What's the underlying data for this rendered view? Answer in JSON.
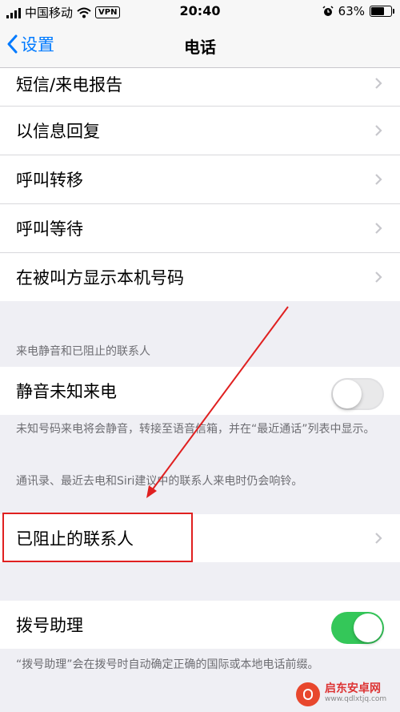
{
  "status_bar": {
    "carrier": "中国移动",
    "vpn": "VPN",
    "time": "20:40",
    "battery": "63%",
    "battery_level": 0.63,
    "icons": [
      "signal-icon",
      "wifi-icon",
      "alarm-icon",
      "battery-icon"
    ]
  },
  "nav": {
    "back_label": "设置",
    "title": "电话"
  },
  "group1": {
    "items": [
      {
        "label": "短信/来电报告"
      },
      {
        "label": "以信息回复"
      },
      {
        "label": "呼叫转移"
      },
      {
        "label": "呼叫等待"
      },
      {
        "label": "在被叫方显示本机号码"
      }
    ]
  },
  "silence_section": {
    "header": "来电静音和已阻止的联系人",
    "silence_unknown": {
      "label": "静音未知来电",
      "enabled": false
    },
    "note1": "未知号码来电将会静音，转接至语音信箱，并在“最近通话”列表中显示。",
    "note2": "通讯录、最近去电和Siri建议中的联系人来电时仍会响铃。"
  },
  "blocked": {
    "label": "已阻止的联系人"
  },
  "dial_assist": {
    "label": "拨号助理",
    "enabled": true,
    "note": "“拨号助理”会在拨号时自动确定正确的国际或本地电话前缀。"
  },
  "watermark": {
    "name": "启东安卓网",
    "url": "www.qdlxtjq.com"
  },
  "colors": {
    "accent": "#007aff",
    "switch_on": "#34c759",
    "annotation": "#e02020",
    "background": "#efeff4"
  }
}
